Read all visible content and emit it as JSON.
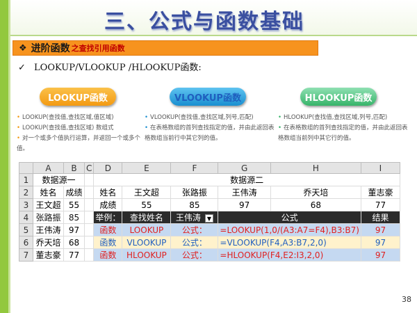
{
  "slide": {
    "title": "三、公式与函数基础",
    "section_label": "进阶函数",
    "section_sub": "之查找引用函数",
    "check_text": "LOOKUP/VLOOKUP /HLOOKUP函数:",
    "page_number": "38"
  },
  "pills": [
    {
      "label": "LOOKUP函数"
    },
    {
      "label": "VLOOKUP函数"
    },
    {
      "label": "HLOOKUP函数"
    }
  ],
  "desc": {
    "c1": [
      "LOOKUP(查找值,查找区域,值区域)",
      "LOOKUP(查找值,查找区域) 数组式",
      "对一个或多个值执行运算，并返回一个或多个值。"
    ],
    "c2": [
      "VLOOKUP(查找值,查找区域,列号,匹配)",
      "在表格数组的首列查找指定的值，并由此返回表格数组当前行中其它列的值。"
    ],
    "c3": [
      "HLOOKUP(查找值,查找区域,列号,匹配)",
      "在表格数组的首列查找指定的值，并由此返回表格数组当前列中其它行的值。"
    ]
  },
  "sheet": {
    "col_headers": [
      "A",
      "B",
      "C",
      "D",
      "E",
      "F",
      "G",
      "H",
      "I"
    ],
    "row_numbers": [
      "1",
      "2",
      "3",
      "4",
      "5",
      "6",
      "7"
    ],
    "source1_title": "数据源一",
    "source2_title": "数据源二",
    "r2": {
      "a": "姓名",
      "b": "成绩",
      "d": "姓名",
      "e": "王文超",
      "f": "张路振",
      "g": "王伟涛",
      "h": "乔天培",
      "i": "董志豪"
    },
    "r3": {
      "a": "王文超",
      "b": "55",
      "d": "成绩",
      "e": "55",
      "f": "85",
      "g": "97",
      "h": "68",
      "i": "77"
    },
    "r4": {
      "a": "张路振",
      "b": "85",
      "d": "举例：",
      "e": "查找姓名",
      "f": "王伟涛",
      "g": "公式",
      "i": "结果"
    },
    "r5": {
      "a": "王伟涛",
      "b": "97",
      "d": "函数",
      "e": "LOOKUP",
      "f": "公式：",
      "g": "=LOOKUP(1,0/(A3:A7=F4),B3:B7)",
      "i": "97"
    },
    "r6": {
      "a": "乔天培",
      "b": "68",
      "d": "函数",
      "e": "VLOOKUP",
      "f": "公式：",
      "g": "=VLOOKUP(F4,A3:B7,2,0)",
      "i": "97"
    },
    "r7": {
      "a": "董志豪",
      "b": "77",
      "d": "函数",
      "e": "HLOOKUP",
      "f": "公式：",
      "g": "=HLOOKUP(F4,E2:I3,2,0)",
      "i": "97"
    }
  }
}
